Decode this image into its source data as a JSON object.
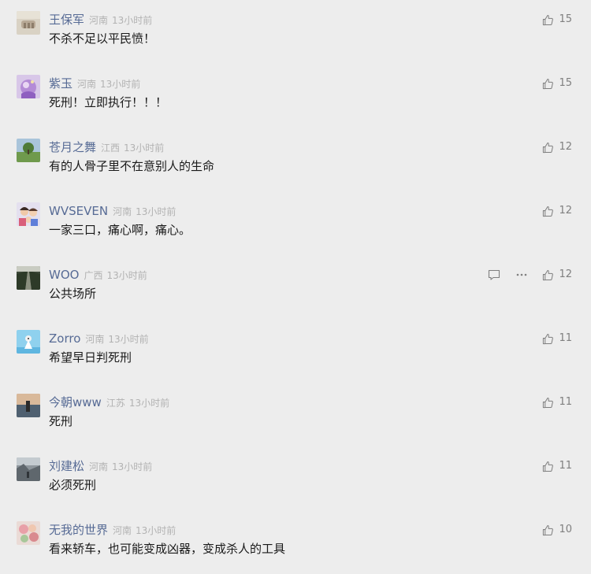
{
  "comments": [
    {
      "name": "王保军",
      "region": "河南",
      "time": "13小时前",
      "text": "不杀不足以平民愤！",
      "likes": "15",
      "avatar": "avatar-icon"
    },
    {
      "name": "紫玉",
      "region": "河南",
      "time": "13小时前",
      "text": "死刑！立即执行！！！",
      "likes": "15",
      "avatar": "avatar-icon"
    },
    {
      "name": "苍月之舞",
      "region": "江西",
      "time": "13小时前",
      "text": "有的人骨子里不在意别人的生命",
      "likes": "12",
      "avatar": "avatar-icon"
    },
    {
      "name": "WVSEVEN",
      "region": "河南",
      "time": "13小时前",
      "text": "一家三口，痛心啊，痛心。",
      "likes": "12",
      "avatar": "avatar-icon"
    },
    {
      "name": "WOO",
      "region": "广西",
      "time": "13小时前",
      "text": "公共场所",
      "likes": "12",
      "avatar": "avatar-icon",
      "show_actions": true
    },
    {
      "name": "Zorro",
      "region": "河南",
      "time": "13小时前",
      "text": "希望早日判死刑",
      "likes": "11",
      "avatar": "avatar-icon"
    },
    {
      "name": "今朝www",
      "region": "江苏",
      "time": "13小时前",
      "text": "死刑",
      "likes": "11",
      "avatar": "avatar-icon"
    },
    {
      "name": "刘建松",
      "region": "河南",
      "time": "13小时前",
      "text": "必须死刑",
      "likes": "11",
      "avatar": "avatar-icon"
    },
    {
      "name": "无我的世界",
      "region": "河南",
      "time": "13小时前",
      "text": "看来轿车，也可能变成凶器，变成杀人的工具",
      "likes": "10",
      "avatar": "avatar-icon"
    }
  ],
  "icons": {
    "like": "thumbs-up-icon",
    "reply": "comment-icon",
    "more": "more-icon"
  },
  "colors": {
    "background": "#ededed",
    "nickname": "#576b95",
    "meta": "#b2b2b2",
    "content": "#1a1a1a",
    "like_count": "#7f7f7f"
  }
}
